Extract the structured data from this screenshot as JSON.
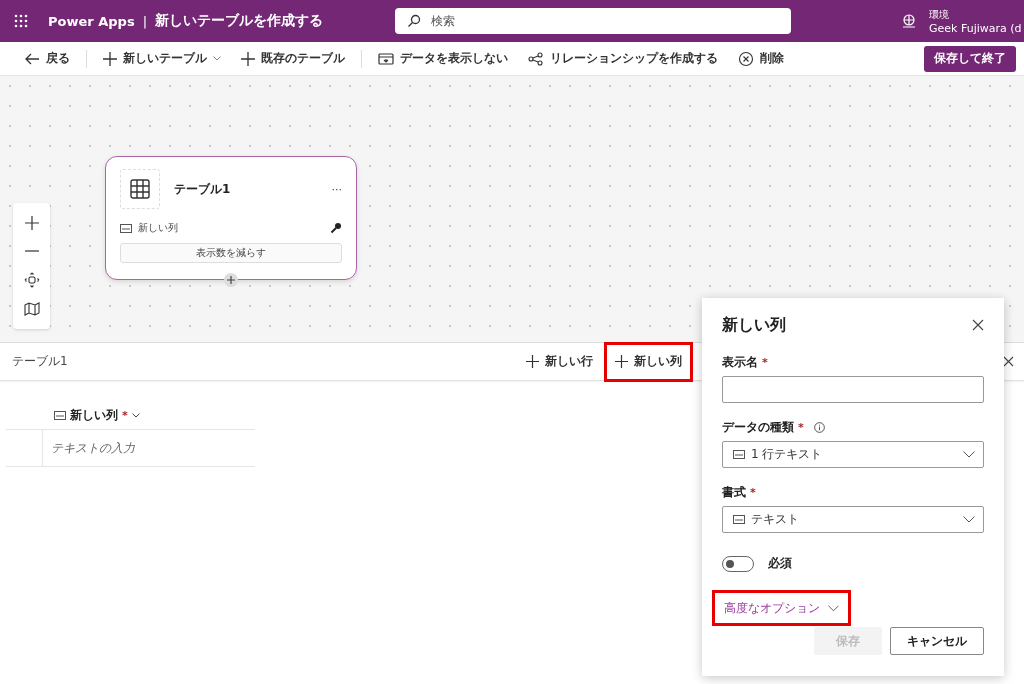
{
  "header": {
    "app_name": "Power Apps",
    "separator": "|",
    "title": "新しいテーブルを作成する",
    "search": {
      "placeholder": "検索"
    },
    "environment_label": "環境",
    "environment_name": "Geek Fujiwara (d"
  },
  "toolbar": [
    {
      "kind": "back",
      "label": "戻る"
    },
    {
      "kind": "divider"
    },
    {
      "kind": "add",
      "label": "新しいテーブル",
      "dropdown": true
    },
    {
      "kind": "add",
      "label": "既存のテーブル",
      "dropdown": false
    },
    {
      "kind": "divider"
    },
    {
      "kind": "hide",
      "label": "データを表示しない"
    },
    {
      "kind": "relation",
      "label": "リレーションシップを作成する"
    },
    {
      "kind": "delete",
      "label": "削除"
    }
  ],
  "save_button": "保存して終了",
  "canvas": {
    "table_card": {
      "title": "テーブル1",
      "menu": "···",
      "columns": [
        {
          "name": "新しい列",
          "primary_key": true
        }
      ],
      "show_less": "表示数を減らす"
    }
  },
  "data_panel": {
    "title": "テーブル1",
    "actions": [
      {
        "label": "新しい行",
        "highlighted": false
      },
      {
        "label": "新しい列",
        "highlighted": true
      }
    ],
    "columns": [
      {
        "name": "新しい列",
        "required_mark": "*"
      }
    ],
    "rows": [
      {
        "placeholder": "テキストの入力"
      }
    ]
  },
  "column_dialog": {
    "title": "新しい列",
    "fields": [
      {
        "kind": "text",
        "label": "表示名",
        "required_mark": "*",
        "info": false
      },
      {
        "kind": "select",
        "label": "データの種類",
        "required_mark": "*",
        "info": true,
        "value": "1 行テキスト"
      },
      {
        "kind": "select",
        "label": "書式",
        "required_mark": "*",
        "info": false,
        "value": "テキスト"
      }
    ],
    "required_toggle": {
      "label": "必須",
      "on": false
    },
    "advanced": {
      "label": "高度なオプション",
      "highlighted": true
    },
    "buttons": [
      {
        "label": "保存",
        "disabled": true
      },
      {
        "label": "キャンセル",
        "disabled": false
      }
    ]
  }
}
